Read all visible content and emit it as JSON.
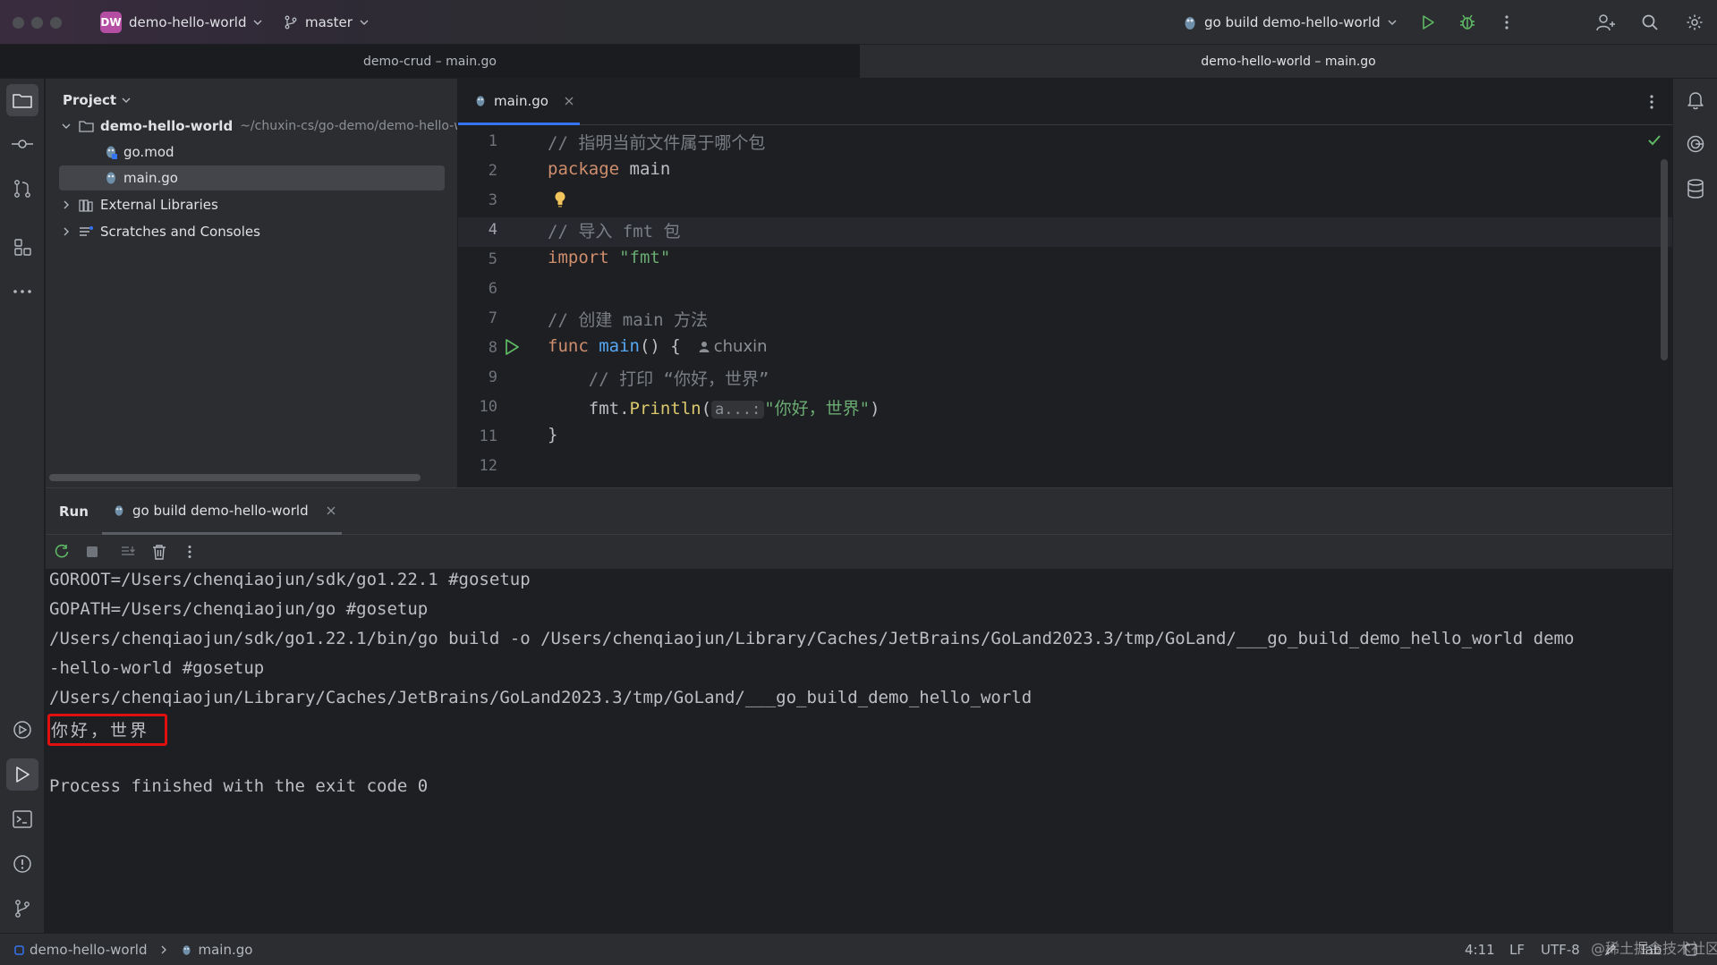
{
  "titlebar": {
    "project_badge": "DW",
    "project_name": "demo-hello-world",
    "branch": "master",
    "run_config": "go build demo-hello-world"
  },
  "window_tabs": [
    {
      "label": "demo-crud – main.go"
    },
    {
      "label": "demo-hello-world – main.go"
    }
  ],
  "project_panel": {
    "title": "Project",
    "tree": [
      {
        "label": "demo-hello-world",
        "path": "~/chuxin-cs/go-demo/demo-hello-w"
      },
      {
        "label": "go.mod"
      },
      {
        "label": "main.go"
      },
      {
        "label": "External Libraries"
      },
      {
        "label": "Scratches and Consoles"
      }
    ]
  },
  "editor": {
    "tab_label": "main.go",
    "line_numbers": [
      "1",
      "2",
      "3",
      "4",
      "5",
      "6",
      "7",
      "8",
      "9",
      "10",
      "11",
      "12"
    ],
    "current_line": 4,
    "code": {
      "l1": "// 指明当前文件属于哪个包",
      "l2_kw": "package",
      "l2_name": " main",
      "l4": "// 导入 fmt 包",
      "l5_kw": "import",
      "l5_str": " \"fmt\"",
      "l7": "// 创建 main 方法",
      "l8_kw": "func",
      "l8_fn": " main",
      "l8_rest": "() {",
      "l8_author": "chuxin",
      "l9": "    // 打印 “你好，世界”",
      "l10_pkg": "    fmt.",
      "l10_call": "Println",
      "l10_open": "(",
      "l10_hint": "a...:",
      "l10_str": "\"你好，世界\"",
      "l10_close": ")",
      "l11": "}"
    }
  },
  "run_panel": {
    "title": "Run",
    "tab_label": "go build demo-hello-world",
    "console": [
      "GOROOT=/Users/chenqiaojun/sdk/go1.22.1 #gosetup",
      "GOPATH=/Users/chenqiaojun/go #gosetup",
      "/Users/chenqiaojun/sdk/go1.22.1/bin/go build -o /Users/chenqiaojun/Library/Caches/JetBrains/GoLand2023.3/tmp/GoLand/___go_build_demo_hello_world demo",
      "-hello-world #gosetup",
      "/Users/chenqiaojun/Library/Caches/JetBrains/GoLand2023.3/tmp/GoLand/___go_build_demo_hello_world",
      "你好，世界",
      "",
      "Process finished with the exit code 0"
    ]
  },
  "statusbar": {
    "breadcrumb_project": "demo-hello-world",
    "breadcrumb_file": "main.go",
    "position": "4:11",
    "line_ending": "LF",
    "encoding": "UTF-8",
    "indent": "Tab",
    "watermark": "@稀土掘金技术社区"
  },
  "colors": {
    "accent": "#3574f0",
    "run_green": "#5fb865",
    "highlight_red": "#e01010",
    "badge": "#b34ea3"
  }
}
